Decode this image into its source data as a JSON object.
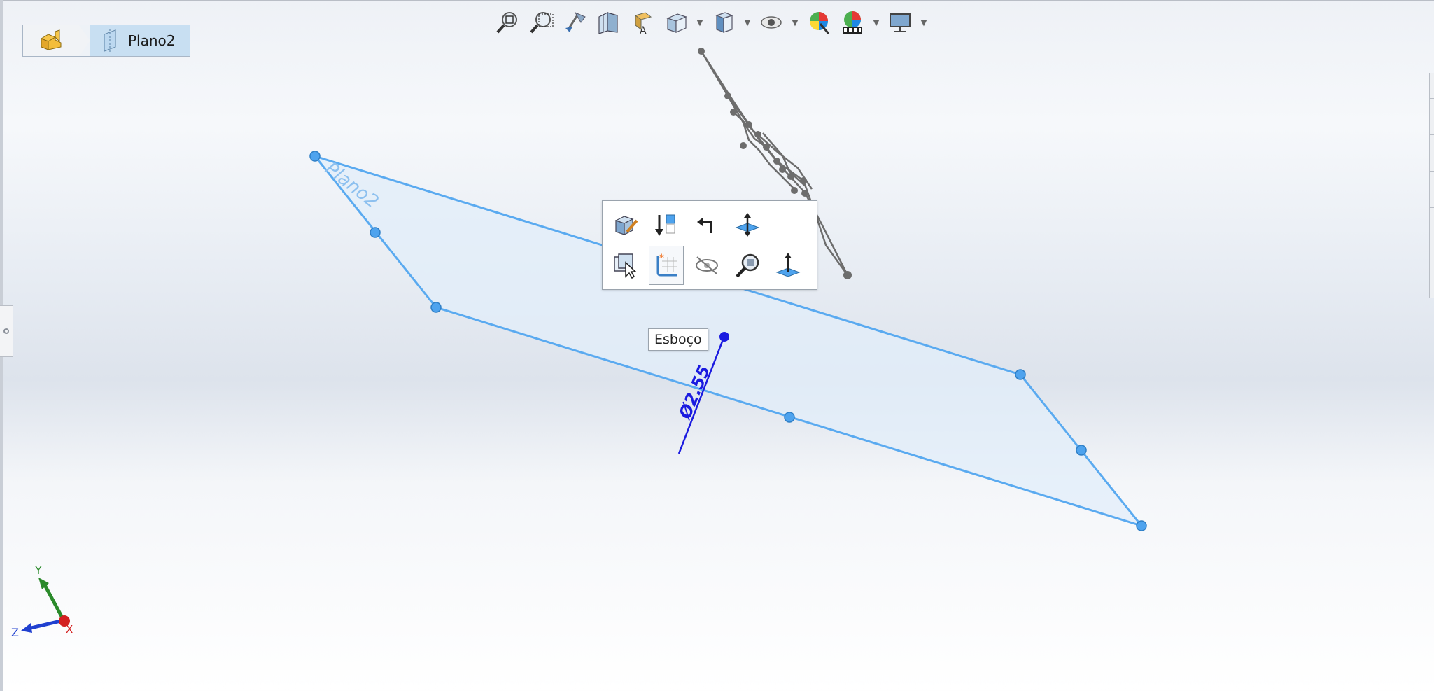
{
  "breadcrumb": {
    "part_icon": "part-icon",
    "plane_icon": "plane-icon",
    "label": "Plano2"
  },
  "headsup_toolbar": {
    "items": [
      {
        "icon": "zoom-to-fit-icon"
      },
      {
        "icon": "zoom-to-area-icon"
      },
      {
        "icon": "previous-view-icon"
      },
      {
        "icon": "section-view-icon"
      },
      {
        "icon": "dynamic-annotation-views-icon"
      },
      {
        "icon": "view-orientation-icon",
        "dropdown": true
      },
      {
        "icon": "display-style-icon",
        "dropdown": true
      },
      {
        "icon": "hide-show-items-icon",
        "dropdown": true
      },
      {
        "icon": "edit-appearance-icon"
      },
      {
        "icon": "apply-scene-icon",
        "dropdown": true
      },
      {
        "icon": "view-settings-icon",
        "dropdown": true
      }
    ]
  },
  "context_toolbar": {
    "row1": [
      "edit-feature-icon",
      "rollback-icon",
      "parent-child-icon",
      "normal-to-icon"
    ],
    "row2": [
      "select-other-icon",
      "sketch-icon",
      "hide-icon",
      "zoom-to-selection-icon",
      "normal-to-plane-icon"
    ],
    "active": "sketch-icon"
  },
  "tooltip": {
    "text": "Esboço"
  },
  "plane_label": "Plano2",
  "dimension_label": "Ø2.55",
  "triad": {
    "x": "X",
    "y": "Y",
    "z": "Z"
  },
  "colors": {
    "plane_edge": "#5aaaf0",
    "plane_fill": "#e4eefa",
    "sketch_blue": "#1a1ae0",
    "wireframe_gray": "#6d6d6d",
    "axis_x": "#d32020",
    "axis_y": "#2a8a2a",
    "axis_z": "#2040d0"
  }
}
